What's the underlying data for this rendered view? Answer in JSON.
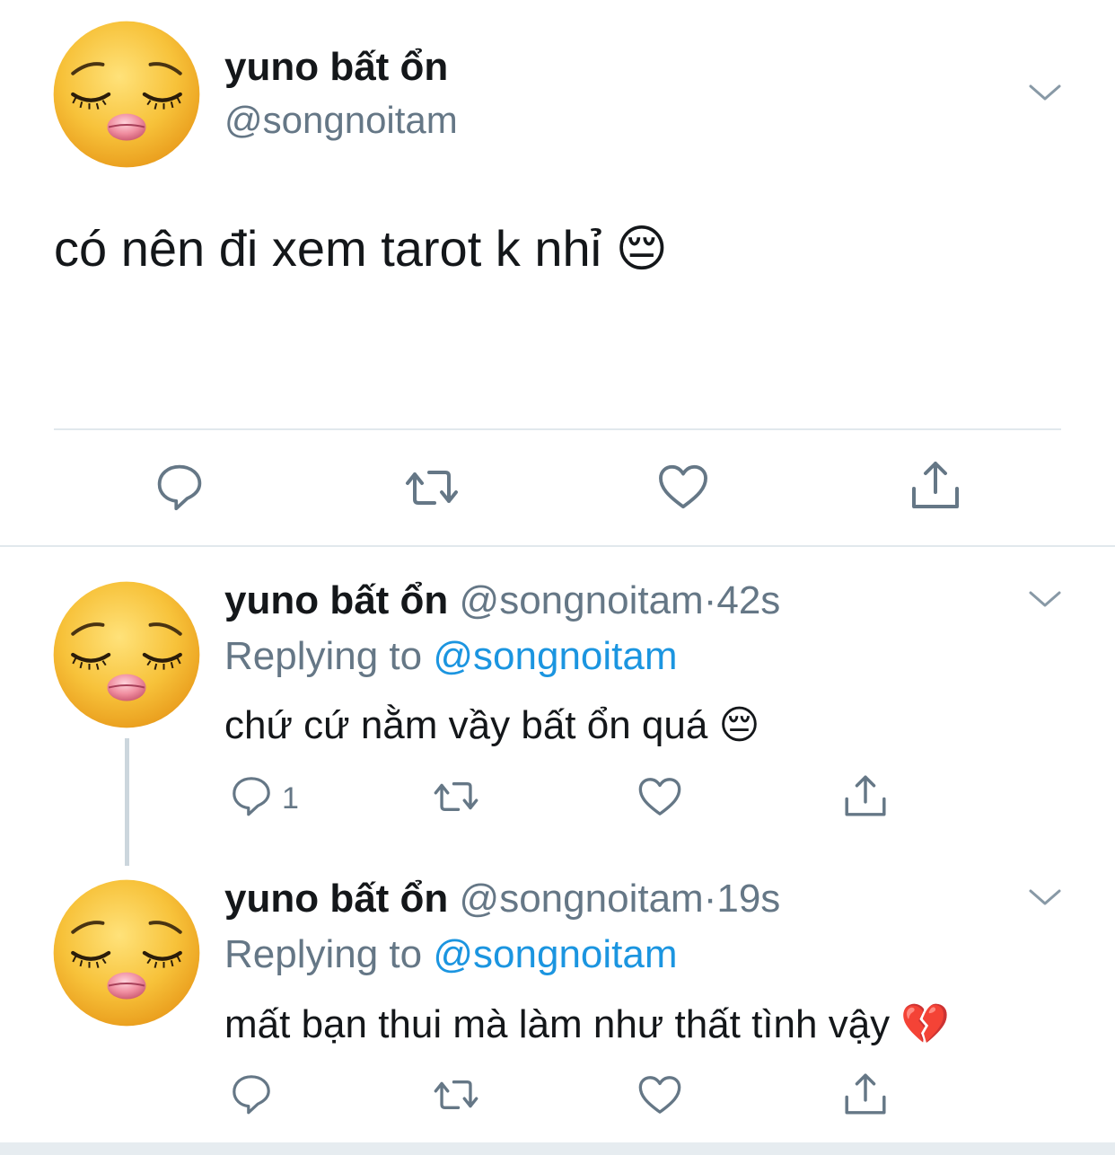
{
  "main_tweet": {
    "display_name": "yuno bất ổn",
    "handle": "@songnoitam",
    "text": "có nên đi xem tarot k nhỉ",
    "emoji": "😔"
  },
  "replies": [
    {
      "display_name": "yuno bất ổn",
      "handle": "@songnoitam",
      "separator": "·",
      "time": "42s",
      "replying_prefix": "Replying to",
      "replying_handle": "@songnoitam",
      "text": "chứ cứ nằm vầy bất ổn quá",
      "emoji": "😔",
      "reply_count": "1"
    },
    {
      "display_name": "yuno bất ổn",
      "handle": "@songnoitam",
      "separator": "·",
      "time": "19s",
      "replying_prefix": "Replying to",
      "replying_handle": "@songnoitam",
      "text": "mất bạn thui mà làm như thất tình vậy",
      "emoji": "💔",
      "reply_count": ""
    }
  ],
  "colors": {
    "text": "#14171a",
    "muted": "#657786",
    "link": "#1b95e0",
    "icon": "#657786",
    "divider": "#e1e8ed",
    "avatar_face": "#f7c23a"
  },
  "icons": [
    "pensive-face-avatar",
    "chevron-down-icon",
    "reply-icon",
    "retweet-icon",
    "like-icon",
    "share-icon"
  ]
}
